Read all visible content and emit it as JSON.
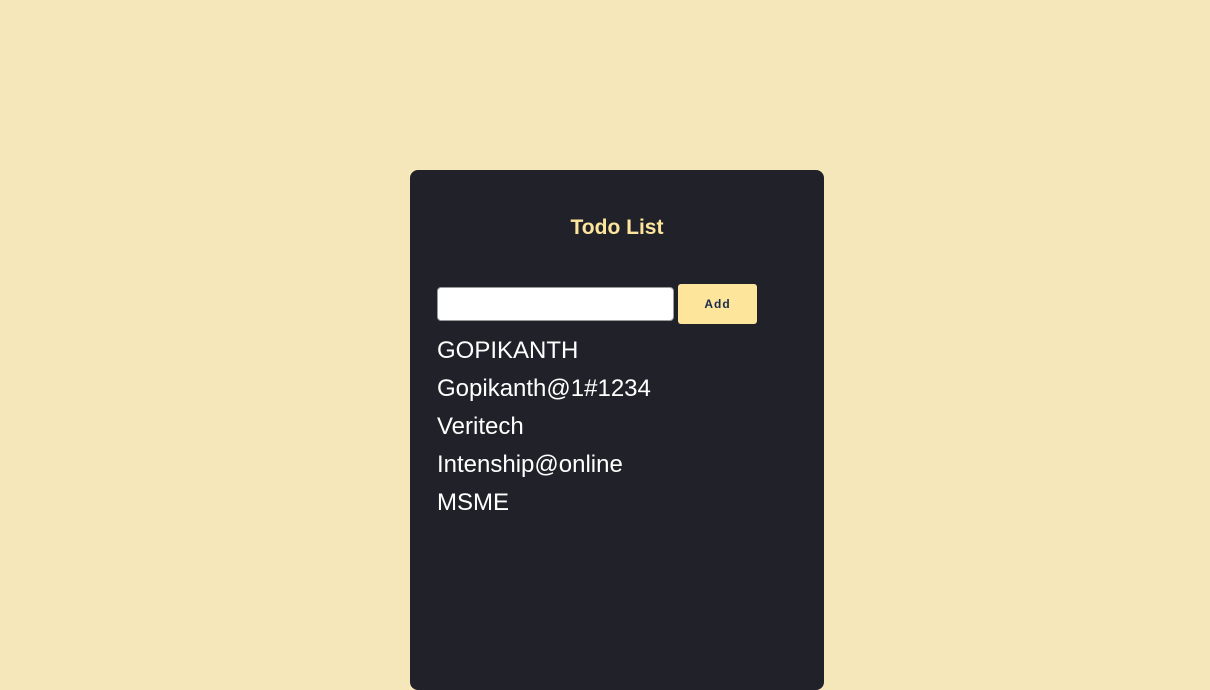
{
  "app": {
    "title": "Todo List"
  },
  "form": {
    "input_value": "",
    "input_placeholder": "",
    "add_label": "Add"
  },
  "todos": [
    "GOPIKANTH",
    "Gopikanth@1#1234",
    "Veritech",
    "Intenship@online",
    "MSME"
  ],
  "colors": {
    "background": "#f5e7b9",
    "card": "#21212a",
    "accent": "#fde69c",
    "button_text": "#1b2a4a",
    "item_text": "#ffffff"
  }
}
